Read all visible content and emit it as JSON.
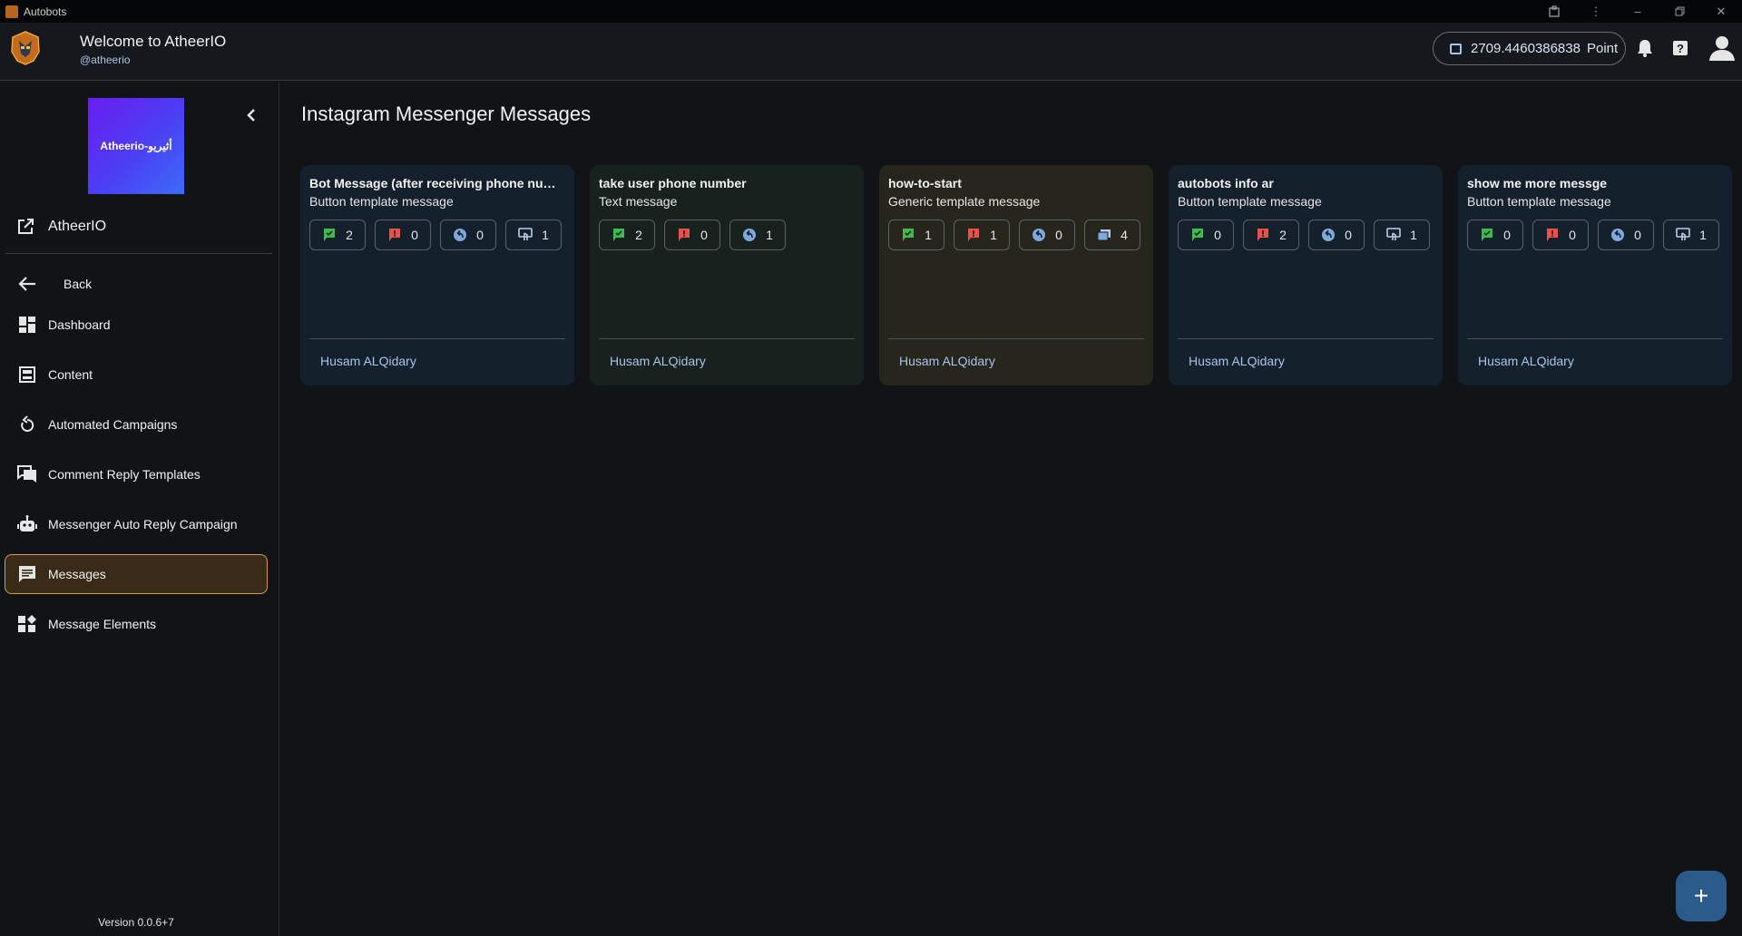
{
  "window": {
    "title": "Autobots"
  },
  "header": {
    "welcome": "Welcome to AtheerIO",
    "handle": "@atheerio",
    "points_value": "2709.4460386838",
    "points_unit": "Point"
  },
  "sidebar": {
    "brand_text": "Atheerio-أثيريو",
    "org_name": "AtheerIO",
    "back_label": "Back",
    "items": [
      {
        "label": "Dashboard",
        "icon": "dashboard-icon",
        "active": false
      },
      {
        "label": "Content",
        "icon": "content-icon",
        "active": false
      },
      {
        "label": "Automated Campaigns",
        "icon": "refresh-icon",
        "active": false
      },
      {
        "label": "Comment Reply Templates",
        "icon": "comments-icon",
        "active": false
      },
      {
        "label": "Messenger Auto Reply Campaign",
        "icon": "robot-icon",
        "active": false
      },
      {
        "label": "Messages",
        "icon": "message-icon",
        "active": true
      },
      {
        "label": "Message Elements",
        "icon": "widgets-icon",
        "active": false
      }
    ],
    "version": "Version 0.0.6+7"
  },
  "main": {
    "title": "Instagram Messenger Messages",
    "cards": [
      {
        "name": "Bot Message (after receiving phone numb...",
        "type": "Button template message",
        "author": "Husam ALQidary",
        "color": "#15202d",
        "stats": [
          {
            "icon": "flag-green-icon",
            "value": "2"
          },
          {
            "icon": "flag-red-icon",
            "value": "0"
          },
          {
            "icon": "reply-icon",
            "value": "0"
          },
          {
            "icon": "tap-icon",
            "value": "1"
          }
        ]
      },
      {
        "name": "take user phone number",
        "type": "Text message",
        "author": "Husam ALQidary",
        "color": "#17211e",
        "stats": [
          {
            "icon": "flag-green-icon",
            "value": "2"
          },
          {
            "icon": "flag-red-icon",
            "value": "0"
          },
          {
            "icon": "reply-icon",
            "value": "1"
          }
        ]
      },
      {
        "name": "how-to-start",
        "type": "Generic template message",
        "author": "Husam ALQidary",
        "color": "#27261d",
        "stats": [
          {
            "icon": "flag-green-icon",
            "value": "1"
          },
          {
            "icon": "flag-red-icon",
            "value": "1"
          },
          {
            "icon": "reply-icon",
            "value": "0"
          },
          {
            "icon": "cards-icon",
            "value": "4"
          }
        ]
      },
      {
        "name": "autobots info ar",
        "type": "Button template message",
        "author": "Husam ALQidary",
        "color": "#15202d",
        "stats": [
          {
            "icon": "flag-green-icon",
            "value": "0"
          },
          {
            "icon": "flag-red-icon",
            "value": "2"
          },
          {
            "icon": "reply-icon",
            "value": "0"
          },
          {
            "icon": "tap-icon",
            "value": "1"
          }
        ]
      },
      {
        "name": "show me more messge",
        "type": "Button template message",
        "author": "Husam ALQidary",
        "color": "#15202d",
        "stats": [
          {
            "icon": "flag-green-icon",
            "value": "0"
          },
          {
            "icon": "flag-red-icon",
            "value": "0"
          },
          {
            "icon": "reply-icon",
            "value": "0"
          },
          {
            "icon": "tap-icon",
            "value": "1"
          }
        ]
      }
    ]
  },
  "fab": {
    "label": "+"
  }
}
